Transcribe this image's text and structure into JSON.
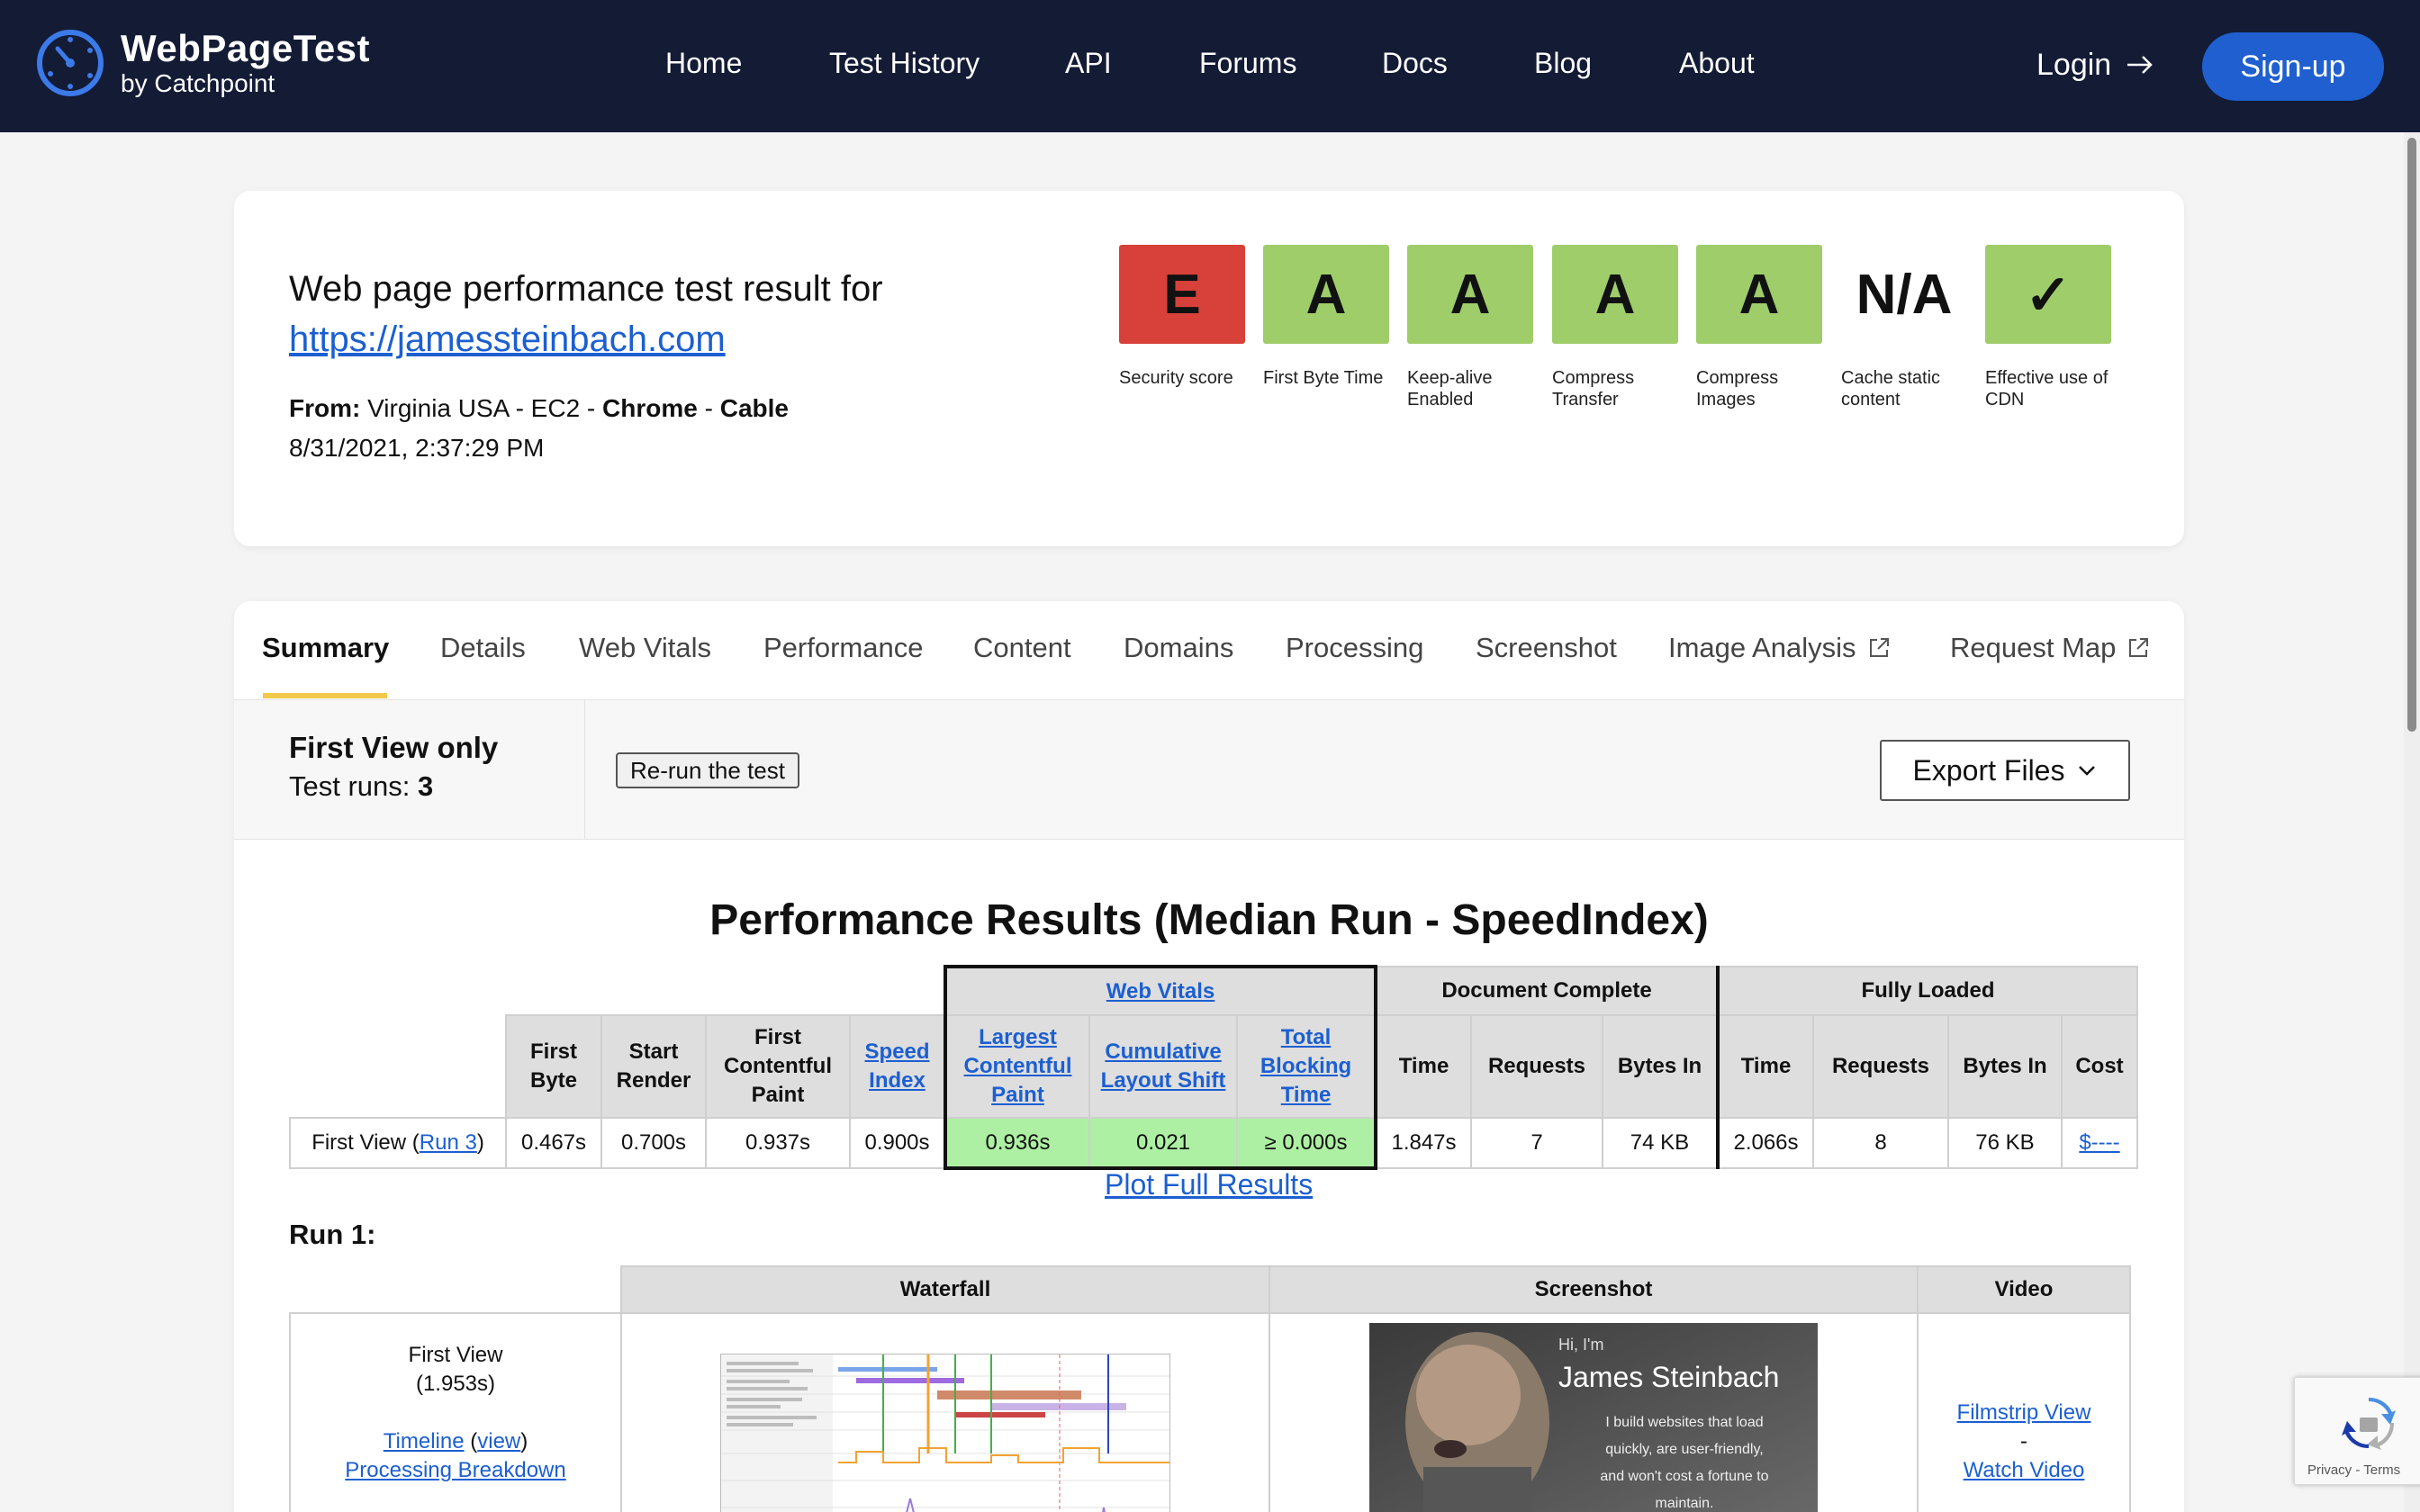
{
  "header": {
    "logo_title": "WebPageTest",
    "logo_sub": "by Catchpoint",
    "nav": [
      "Home",
      "Test History",
      "API",
      "Forums",
      "Docs",
      "Blog",
      "About"
    ],
    "login": "Login",
    "signup": "Sign-up",
    "colors": {
      "bar": "#131b35",
      "signup": "#1f5fcf"
    }
  },
  "summary": {
    "title_prefix": "Web page performance test result for",
    "url": "https://jamessteinbach.com",
    "from_label": "From:",
    "location": "Virginia USA - EC2 -",
    "browser": "Chrome",
    "separator": "-",
    "connection": "Cable",
    "date": "8/31/2021, 2:37:29 PM"
  },
  "grades": [
    {
      "value": "E",
      "label": "Security score",
      "color": "#d8403a"
    },
    {
      "value": "A",
      "label": "First Byte Time",
      "color": "#9ecd6a"
    },
    {
      "value": "A",
      "label": "Keep-alive Enabled",
      "color": "#9ecd6a"
    },
    {
      "value": "A",
      "label": "Compress Transfer",
      "color": "#9ecd6a"
    },
    {
      "value": "A",
      "label": "Compress Images",
      "color": "#9ecd6a"
    },
    {
      "value": "N/A",
      "label": "Cache static content",
      "color": "transparent"
    },
    {
      "value": "✓",
      "label": "Effective use of CDN",
      "color": "#9ecd6a"
    }
  ],
  "tabs": [
    "Summary",
    "Details",
    "Web Vitals",
    "Performance",
    "Content",
    "Domains",
    "Processing",
    "Screenshot",
    "Image Analysis",
    "Request Map"
  ],
  "runbar": {
    "view": "First View only",
    "test_runs_label": "Test runs:",
    "test_runs": "3",
    "rerun": "Re-run the test",
    "export": "Export Files"
  },
  "performance": {
    "title": "Performance Results (Median Run - SpeedIndex)",
    "groups": {
      "web_vitals": "Web Vitals",
      "doc_complete": "Document Complete",
      "fully_loaded": "Fully Loaded"
    },
    "headers": {
      "first_byte": "First Byte",
      "start_render": "Start Render",
      "fcp": "First Contentful Paint",
      "speed_index": "Speed Index",
      "lcp": "Largest Contentful Paint",
      "cls": "Cumulative Layout Shift",
      "tbt": "Total Blocking Time",
      "time": "Time",
      "requests": "Requests",
      "bytes_in": "Bytes In",
      "cost": "Cost"
    },
    "row": {
      "label": "First View (",
      "run_link": "Run 3",
      "label_end": ")",
      "first_byte": "0.467s",
      "start_render": "0.700s",
      "fcp": "0.937s",
      "speed_index": "0.900s",
      "lcp": "0.936s",
      "cls": "0.021",
      "tbt": "≥ 0.000s",
      "dc_time": "1.847s",
      "dc_requests": "7",
      "dc_bytes": "74 KB",
      "fl_time": "2.066s",
      "fl_requests": "8",
      "fl_bytes": "76 KB",
      "cost": "$----"
    },
    "plot_link": "Plot Full Results"
  },
  "run1": {
    "title": "Run 1:",
    "headers": {
      "waterfall": "Waterfall",
      "screenshot": "Screenshot",
      "video": "Video"
    },
    "first_view": "First View",
    "first_view_time": "(1.953s)",
    "timeline": "Timeline",
    "view": "view",
    "processing": "Processing Breakdown",
    "filmstrip": "Filmstrip View",
    "dash": "-",
    "watch": "Watch Video",
    "screenshot_text": {
      "hi": "Hi, I'm",
      "name": "James Steinbach",
      "line1": "I build websites that load",
      "line2": "quickly, are user-friendly,",
      "line3": "and won't cost a fortune to",
      "line4": "maintain."
    }
  },
  "recaptcha": {
    "terms": "Privacy - Terms"
  }
}
